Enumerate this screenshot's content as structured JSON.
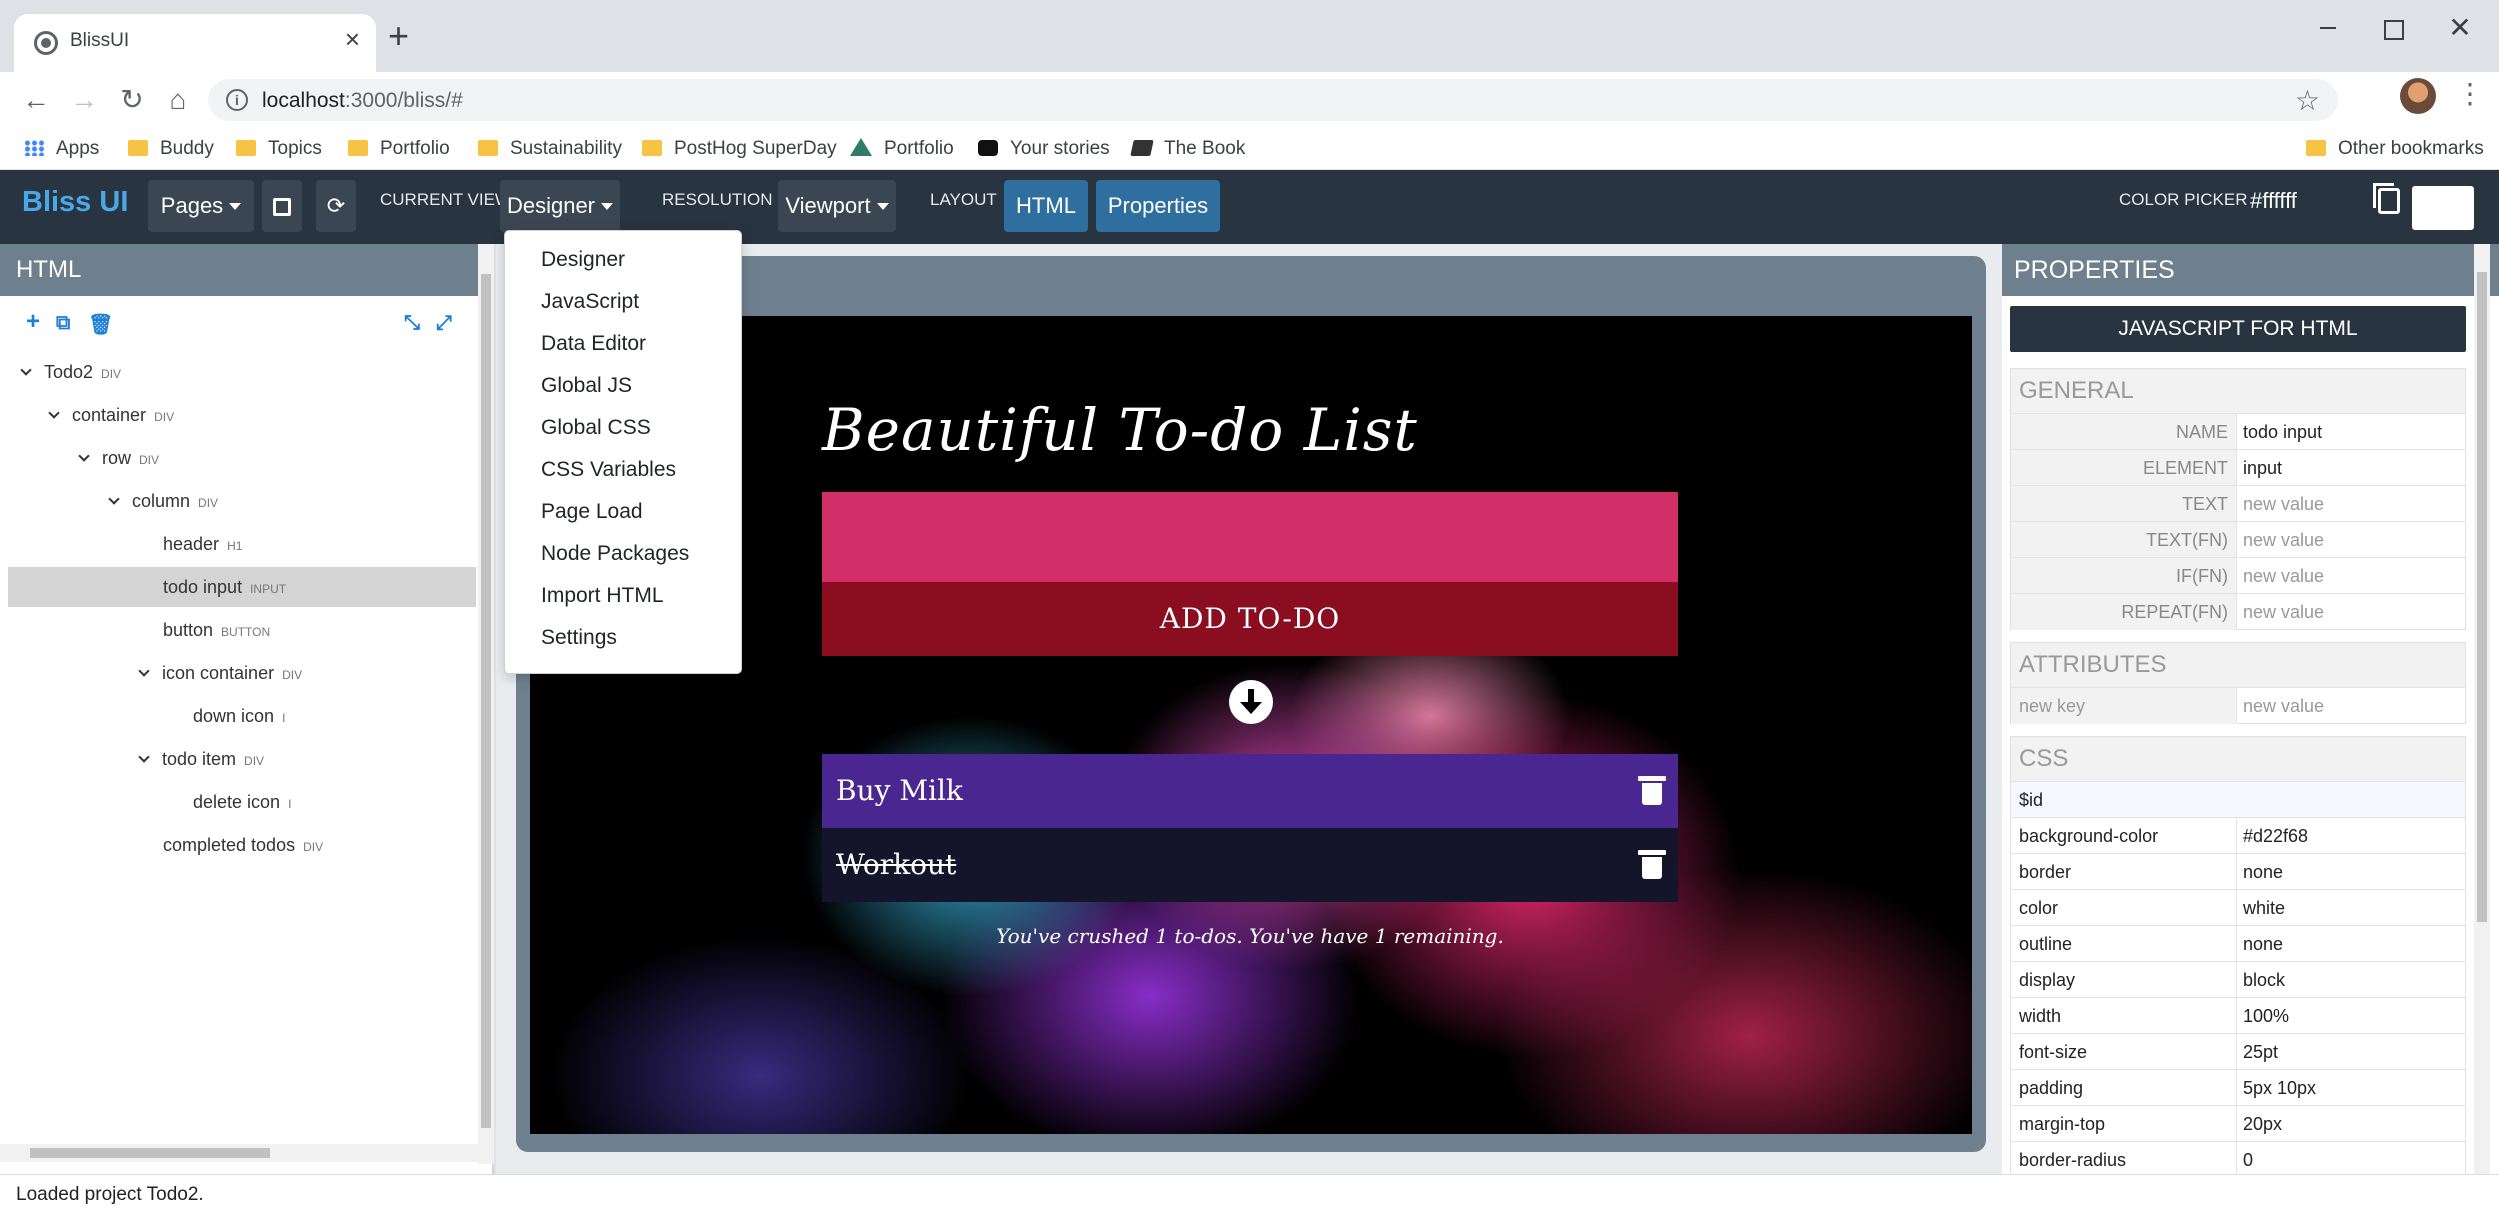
{
  "browser": {
    "tab_title": "BlissUI",
    "url_host": "localhost",
    "url_rest": ":3000/bliss/#",
    "bookmarks": [
      "Apps",
      "Buddy",
      "Topics",
      "Portfolio",
      "Sustainability",
      "PostHog SuperDay",
      "Portfolio",
      "Your stories",
      "The Book"
    ],
    "other_bookmarks": "Other bookmarks"
  },
  "header": {
    "brand": "Bliss UI",
    "pages_label": "Pages",
    "current_view_label": "CURRENT VIEW",
    "current_view_value": "Designer",
    "resolution_label": "RESOLUTION",
    "resolution_value": "Viewport",
    "layout_label": "LAYOUT",
    "layout_html": "HTML",
    "layout_properties": "Properties",
    "color_picker_label": "COLOR PICKER",
    "color_picker_value": "#ffffff",
    "swatch_color": "#ffffff"
  },
  "view_menu": [
    "Designer",
    "JavaScript",
    "Data Editor",
    "Global JS",
    "Global CSS",
    "CSS Variables",
    "Page Load",
    "Node Packages",
    "Import HTML",
    "Settings"
  ],
  "left": {
    "title": "HTML",
    "tree": [
      {
        "label": "Todo2",
        "tag": "DIV",
        "expanded": true
      },
      {
        "label": "container",
        "tag": "DIV",
        "expanded": true
      },
      {
        "label": "row",
        "tag": "DIV",
        "expanded": true
      },
      {
        "label": "column",
        "tag": "DIV",
        "expanded": true
      },
      {
        "label": "header",
        "tag": "H1"
      },
      {
        "label": "todo input",
        "tag": "INPUT",
        "selected": true
      },
      {
        "label": "button",
        "tag": "BUTTON"
      },
      {
        "label": "icon container",
        "tag": "DIV",
        "expanded": true
      },
      {
        "label": "down icon",
        "tag": "I"
      },
      {
        "label": "todo item",
        "tag": "DIV",
        "expanded": true
      },
      {
        "label": "delete icon",
        "tag": "I"
      },
      {
        "label": "completed todos",
        "tag": "DIV"
      }
    ]
  },
  "preview": {
    "title": "Beautiful To-do List",
    "add_button": "ADD TO-DO",
    "items": [
      {
        "text": "Buy Milk",
        "done": false
      },
      {
        "text": "Workout",
        "done": true
      }
    ],
    "summary": "You've crushed 1 to-dos. You've have 1 remaining."
  },
  "right": {
    "title": "PROPERTIES",
    "js_button": "JAVASCRIPT FOR HTML",
    "general_title": "GENERAL",
    "general": [
      {
        "key": "NAME",
        "value": "todo input",
        "placeholder": false
      },
      {
        "key": "ELEMENT",
        "value": "input",
        "placeholder": false
      },
      {
        "key": "TEXT",
        "value": "new value",
        "placeholder": true
      },
      {
        "key": "TEXT(FN)",
        "value": "new value",
        "placeholder": true
      },
      {
        "key": "IF(FN)",
        "value": "new value",
        "placeholder": true
      },
      {
        "key": "REPEAT(FN)",
        "value": "new value",
        "placeholder": true
      }
    ],
    "attributes_title": "ATTRIBUTES",
    "attributes": [
      {
        "key": "new key",
        "value": "new value"
      }
    ],
    "css_title": "CSS",
    "css_selector": "$id",
    "css": [
      {
        "key": "background-color",
        "value": "#d22f68"
      },
      {
        "key": "border",
        "value": "none"
      },
      {
        "key": "color",
        "value": "white"
      },
      {
        "key": "outline",
        "value": "none"
      },
      {
        "key": "display",
        "value": "block"
      },
      {
        "key": "width",
        "value": "100%"
      },
      {
        "key": "font-size",
        "value": "25pt"
      },
      {
        "key": "padding",
        "value": "5px 10px"
      },
      {
        "key": "margin-top",
        "value": "20px"
      },
      {
        "key": "border-radius",
        "value": "0"
      }
    ]
  },
  "status": "Loaded project Todo2."
}
